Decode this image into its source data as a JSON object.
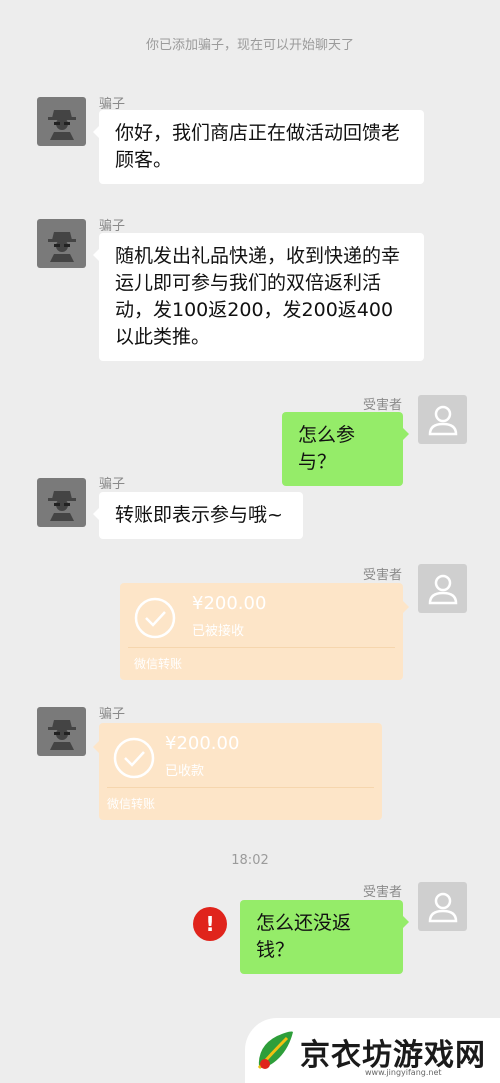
{
  "system_note": "你已添加骗子，现在可以开始聊天了",
  "names": {
    "scammer": "骗子",
    "victim": "受害者"
  },
  "messages": {
    "m1": "你好，我们商店正在做活动回馈老顾客。",
    "m2": "随机发出礼品快递，收到快递的幸运儿即可参与我们的双倍返利活动，发100返200，发200返400以此类推。",
    "m3": "怎么参与？",
    "m4": "转账即表示参与哦~",
    "m6": "怎么还没返钱？"
  },
  "transfers": {
    "t1": {
      "amount": "¥200.00",
      "status": "已被接收",
      "footer": "微信转账"
    },
    "t2": {
      "amount": "¥200.00",
      "status": "已收款",
      "footer": "微信转账"
    }
  },
  "timestamp": "18:02",
  "watermark": {
    "name": "京衣坊游戏网",
    "url": "www.jingyifang.net"
  },
  "colors": {
    "background": "#ededed",
    "sent_bubble": "#95ec69",
    "received_bubble": "#ffffff",
    "transfer": "#fde5c8",
    "error": "#e0241c"
  }
}
